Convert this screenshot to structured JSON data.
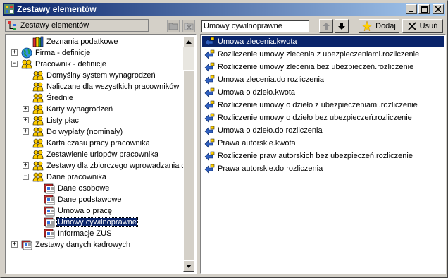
{
  "window": {
    "title": "Zestawy elementów",
    "buttons": {
      "minimize": "_",
      "maximize": "□",
      "close": "×"
    }
  },
  "left_header": {
    "label": "Zestawy elementów"
  },
  "tree": {
    "items": [
      {
        "label": "Zeznania podatkowe",
        "icon": "book-icon",
        "expander": "",
        "selected": false
      },
      {
        "label": "Firma - definicje",
        "icon": "globe-icon",
        "expander": "+",
        "selected": false
      },
      {
        "label": "Pracownik - definicje",
        "icon": "people-icon",
        "expander": "−",
        "selected": false
      },
      {
        "label": "Domyślny system wynagrodzeń",
        "icon": "people-icon",
        "expander": "",
        "selected": false
      },
      {
        "label": "Naliczane dla wszystkich pracowników",
        "icon": "people-icon",
        "expander": "",
        "selected": false
      },
      {
        "label": "Średnie",
        "icon": "people-icon",
        "expander": "",
        "selected": false
      },
      {
        "label": "Karty wynagrodzeń",
        "icon": "people-icon",
        "expander": "+",
        "selected": false
      },
      {
        "label": "Listy płac",
        "icon": "people-icon",
        "expander": "+",
        "selected": false
      },
      {
        "label": "Do wypłaty (nominały)",
        "icon": "people-icon",
        "expander": "+",
        "selected": false
      },
      {
        "label": "Karta czasu pracy pracownika",
        "icon": "people-icon",
        "expander": "",
        "selected": false
      },
      {
        "label": "Zestawienie urlopów pracownika",
        "icon": "people-icon",
        "expander": "",
        "selected": false
      },
      {
        "label": "Zestawy dla zbiorczego wprowadzania da",
        "icon": "people-icon",
        "expander": "+",
        "selected": false
      },
      {
        "label": "Dane pracownika",
        "icon": "people-icon",
        "expander": "−",
        "selected": false
      },
      {
        "label": "Dane osobowe",
        "icon": "card-icon",
        "expander": "",
        "selected": false
      },
      {
        "label": "Dane podstawowe",
        "icon": "card-icon",
        "expander": "",
        "selected": false
      },
      {
        "label": "Umowa o pracę",
        "icon": "card-icon",
        "expander": "",
        "selected": false
      },
      {
        "label": "Umowy cywilnoprawne",
        "icon": "card-icon",
        "expander": "",
        "selected": true
      },
      {
        "label": "Informacje ZUS",
        "icon": "card-icon",
        "expander": "",
        "selected": false
      },
      {
        "label": "Zestawy danych kadrowych",
        "icon": "card-icon",
        "expander": "+",
        "selected": false
      }
    ]
  },
  "search": {
    "value": "Umowy cywilnoprawne"
  },
  "toolbar": {
    "add_label": "Dodaj",
    "remove_label": "Usuń"
  },
  "list": {
    "items": [
      {
        "label": "Umowa zlecenia.kwota",
        "selected": true
      },
      {
        "label": "Rozliczenie umowy zlecenia z ubezpieczeniami.rozliczenie",
        "selected": false
      },
      {
        "label": "Rozliczenie umowy zlecenia bez ubezpieczeń.rozliczenie",
        "selected": false
      },
      {
        "label": "Umowa zlecenia.do rozliczenia",
        "selected": false
      },
      {
        "label": "Umowa o dzieło.kwota",
        "selected": false
      },
      {
        "label": "Rozliczenie umowy o dzieło z ubezpieczeniami.rozliczenie",
        "selected": false
      },
      {
        "label": "Rozliczenie umowy o dzieło bez ubezpieczeń.rozliczenie",
        "selected": false
      },
      {
        "label": "Umowa o dzieło.do rozliczenia",
        "selected": false
      },
      {
        "label": "Prawa autorskie.kwota",
        "selected": false
      },
      {
        "label": "Rozliczenie praw autorskich bez ubezpieczeń.rozliczenie",
        "selected": false
      },
      {
        "label": "Prawa autorskie.do rozliczenia",
        "selected": false
      }
    ]
  },
  "colors": {
    "selection": "#0a246a",
    "face": "#d4d0c8",
    "title_start": "#0a246a",
    "title_end": "#a6caf0"
  }
}
